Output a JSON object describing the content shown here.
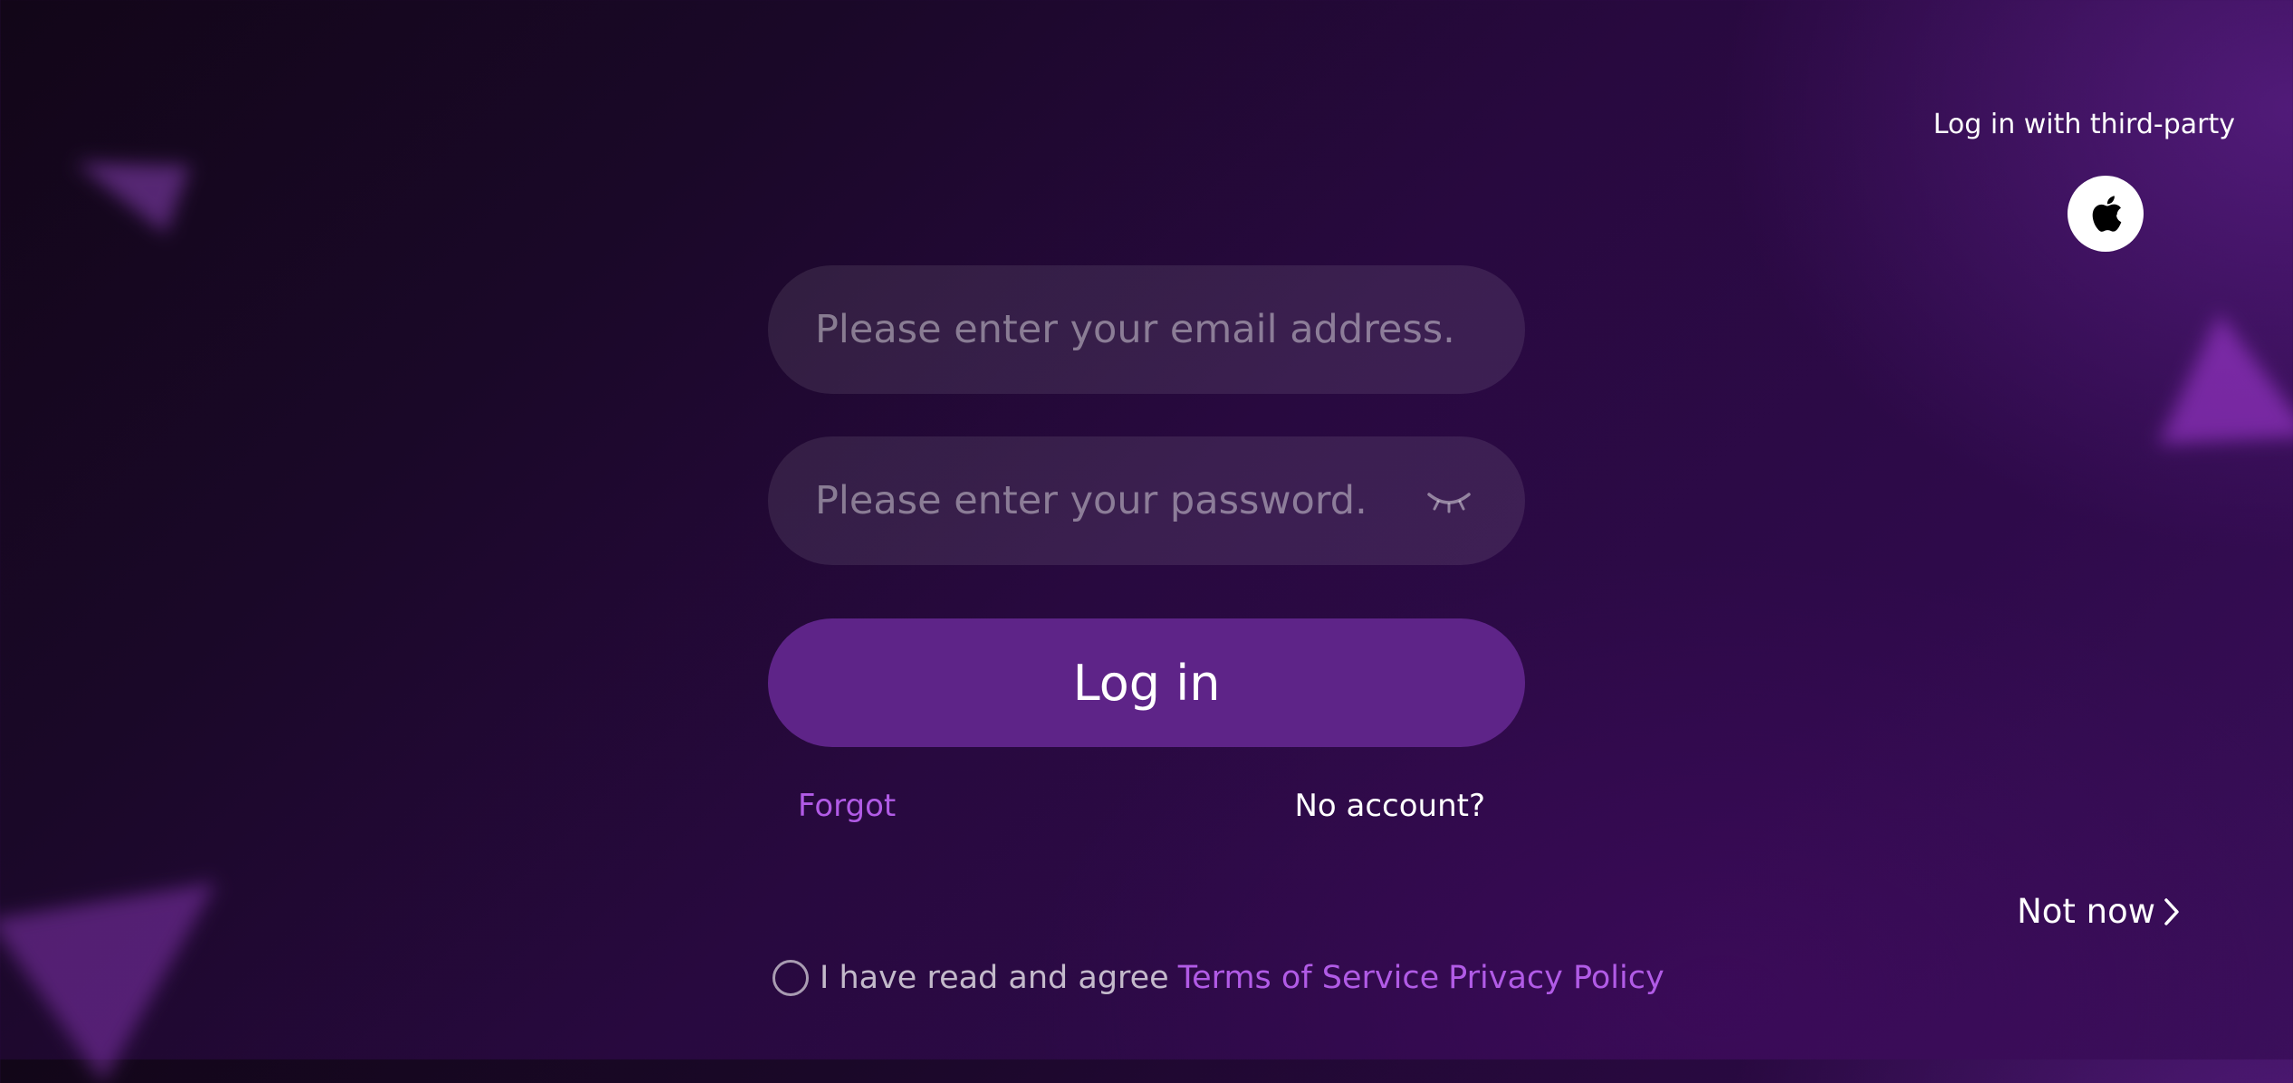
{
  "login_form": {
    "email_placeholder": "Please enter your email address.",
    "password_placeholder": "Please enter your password.",
    "login_label": "Log in",
    "forgot_label": "Forgot",
    "no_account_label": "No account?"
  },
  "third_party": {
    "label": "Log in with third-party",
    "apple_icon": "apple-icon"
  },
  "skip": {
    "label": "Not now",
    "icon": "chevron-right-icon"
  },
  "agreement": {
    "prefix": "I have read and agree",
    "terms_label": "Terms of Service",
    "privacy_label": "Privacy Policy",
    "checked": false
  },
  "colors": {
    "accent": "#b15be6",
    "button": "#5e2488"
  }
}
